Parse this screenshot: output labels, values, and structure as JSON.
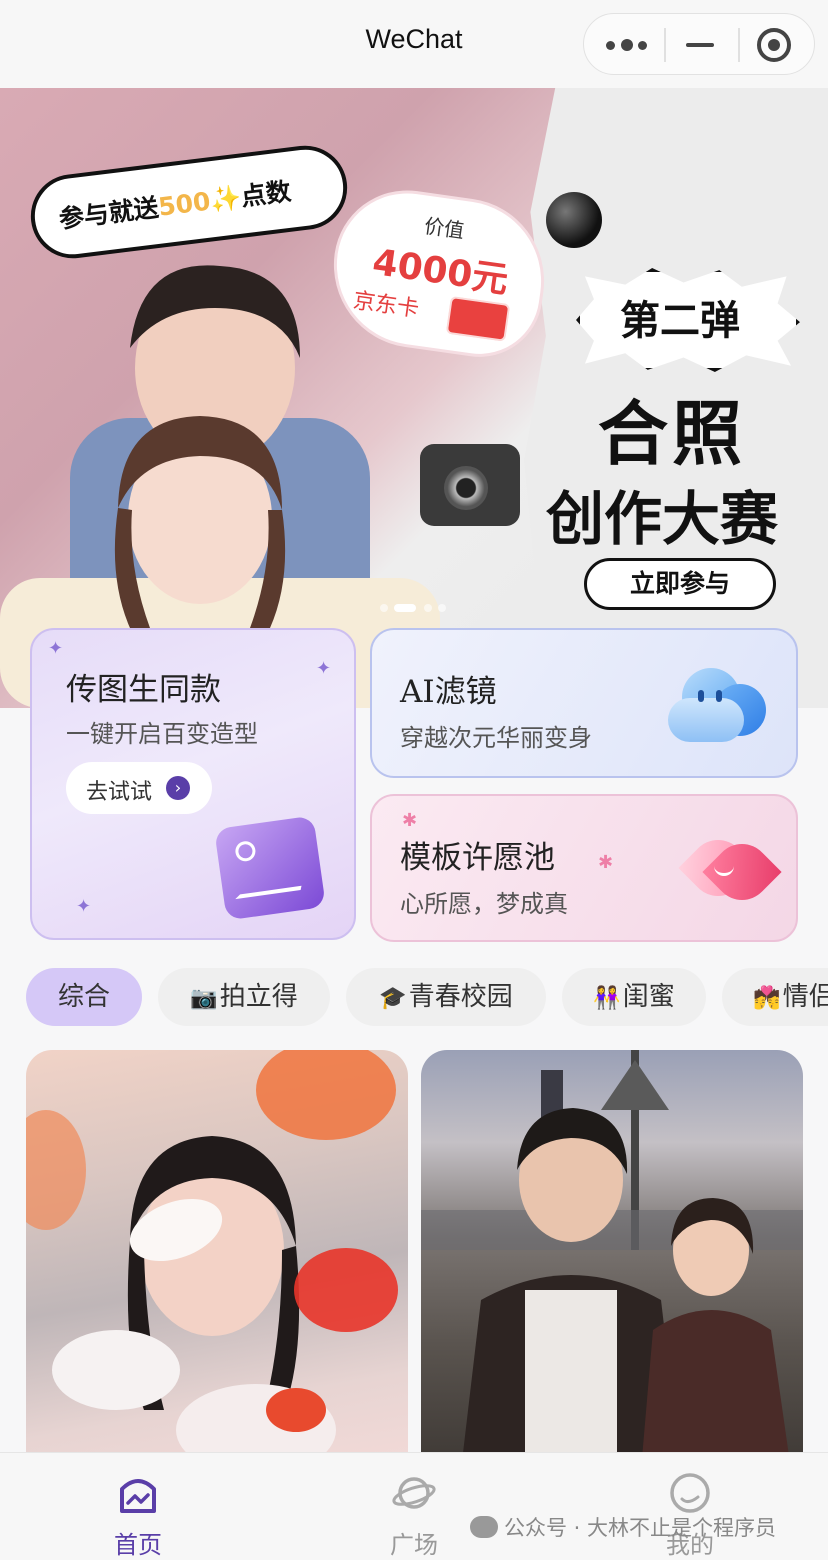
{
  "window": {
    "title": "WeChat",
    "capsule_icons": [
      "more-icon",
      "minimize-icon",
      "close-target-icon"
    ]
  },
  "banner": {
    "promo_bubble": {
      "prefix": "参与就送",
      "number": "500",
      "sparkle": "✨",
      "suffix": "点数"
    },
    "prize": {
      "line1": "价值",
      "line2": "4000元",
      "line3": "京东卡"
    },
    "round": "第二弹",
    "title1": "合照",
    "title2": "创作大赛",
    "cta": "立即参与",
    "carousel": {
      "count": 4,
      "active_index": 1
    }
  },
  "features": {
    "upload": {
      "title": "传图生同款",
      "subtitle": "一键开启百变造型",
      "button": "去试试"
    },
    "ai_filter": {
      "title": "AI滤镜",
      "subtitle": "穿越次元华丽变身"
    },
    "template_pool": {
      "title": "模板许愿池",
      "subtitle": "心所愿，梦成真"
    }
  },
  "categories": [
    {
      "emoji": "",
      "label": "综合",
      "active": true
    },
    {
      "emoji": "📷",
      "label": "拍立得",
      "active": false
    },
    {
      "emoji": "🎓",
      "label": "青春校园",
      "active": false
    },
    {
      "emoji": "👭",
      "label": "闺蜜",
      "active": false
    },
    {
      "emoji": "💏",
      "label": "情侣",
      "active": false
    }
  ],
  "feed": [
    "goldfish-girl-photo",
    "city-couple-photo"
  ],
  "tabbar": {
    "home": "首页",
    "square": "广场",
    "mine": "我的"
  },
  "watermark": "公众号 · 大林不止是个程序员",
  "colors": {
    "accent": "#5a3ea8",
    "active_tab_bg": "#d5c8f7",
    "prize_red": "#e43f3f",
    "bubble_number": "#f3b64a"
  }
}
